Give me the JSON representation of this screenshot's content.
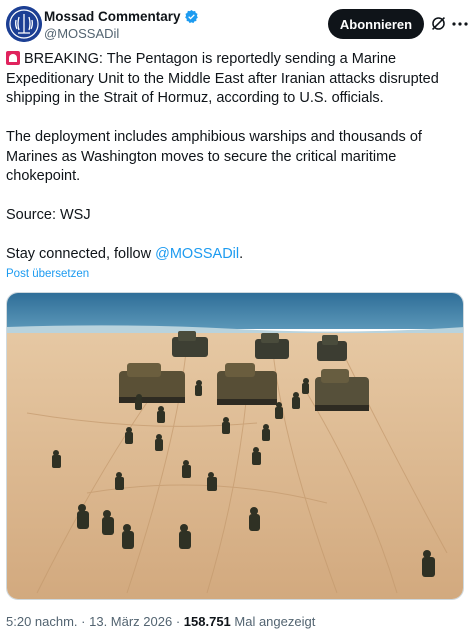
{
  "author": {
    "display_name": "Mossad Commentary",
    "handle": "@MOSSADil",
    "verified": true,
    "brand_color": "#1c3f94"
  },
  "actions": {
    "subscribe_label": "Abonnieren",
    "grok_icon": "grok-icon",
    "more_icon": "more-dots-icon"
  },
  "tweet": {
    "lead_icon": "siren-emoji",
    "paragraph1": "BREAKING: The Pentagon is reportedly sending a Marine Expeditionary Unit to the Middle East after Iranian attacks disrupted shipping in the Strait of Hormuz, according to U.S. officials.",
    "paragraph2": "The deployment includes amphibious warships and thousands of Marines as Washington moves to secure the critical maritime chokepoint.",
    "paragraph3": "Source: WSJ",
    "paragraph4_prefix": "Stay connected, follow ",
    "paragraph4_mention": "@MOSSADil",
    "paragraph4_suffix": ".",
    "translate_label": "Post übersetzen"
  },
  "media": {
    "alt_description_visible": false
  },
  "meta": {
    "time": "5:20 nachm.",
    "separator": " · ",
    "date": "13. März 2026",
    "views_count": "158.751",
    "views_label": " Mal angezeigt"
  },
  "colors": {
    "link": "#1d9bf0",
    "muted": "#536471",
    "text": "#0f1419",
    "sand": "#d9b48c",
    "sea": "#3f7fa6"
  }
}
